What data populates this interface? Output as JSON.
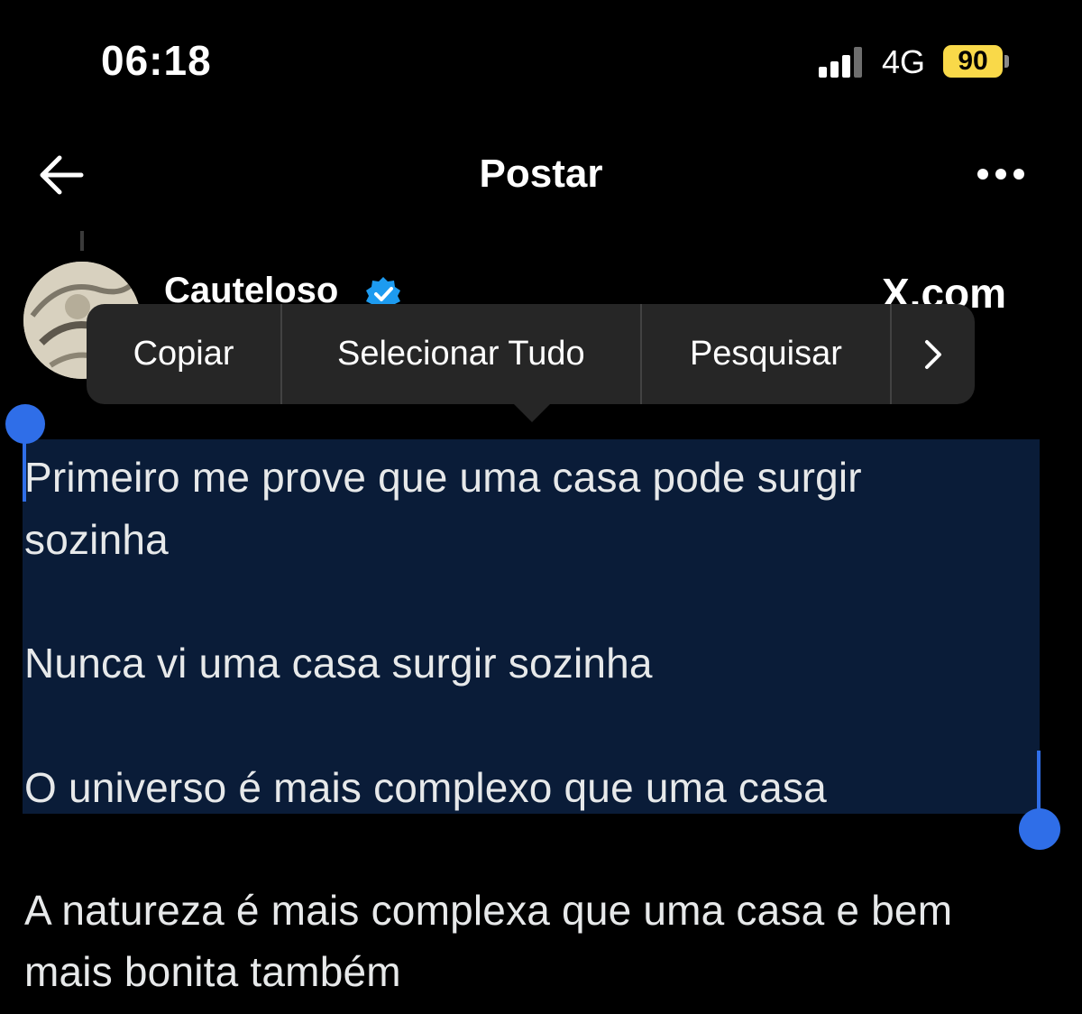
{
  "status_bar": {
    "time": "06:18",
    "network": "4G",
    "battery": "90",
    "battery_color": "#f9d949"
  },
  "header": {
    "back_icon": "arrow-left-icon",
    "title": "Postar",
    "more_icon": "more-horizontal-icon"
  },
  "post": {
    "author": {
      "name": "Cauteloso",
      "verified": true,
      "verified_color": "#1d9bf0",
      "handle": "X.com"
    },
    "lines": [
      "Primeiro me prove que uma casa pode surgir",
      "sozinha",
      "Nunca vi uma casa surgir sozinha",
      "O universo é mais complexo que uma casa",
      "A natureza é mais complexa que uma casa e bem",
      "mais bonita também"
    ]
  },
  "context_menu": {
    "items": [
      {
        "label": "Copiar"
      },
      {
        "label": "Selecionar Tudo"
      },
      {
        "label": "Pesquisar"
      }
    ],
    "next_icon": "chevron-right-icon"
  },
  "selection": {
    "highlight_color": "#0a1c38",
    "handle_color": "#2f6ee8"
  }
}
